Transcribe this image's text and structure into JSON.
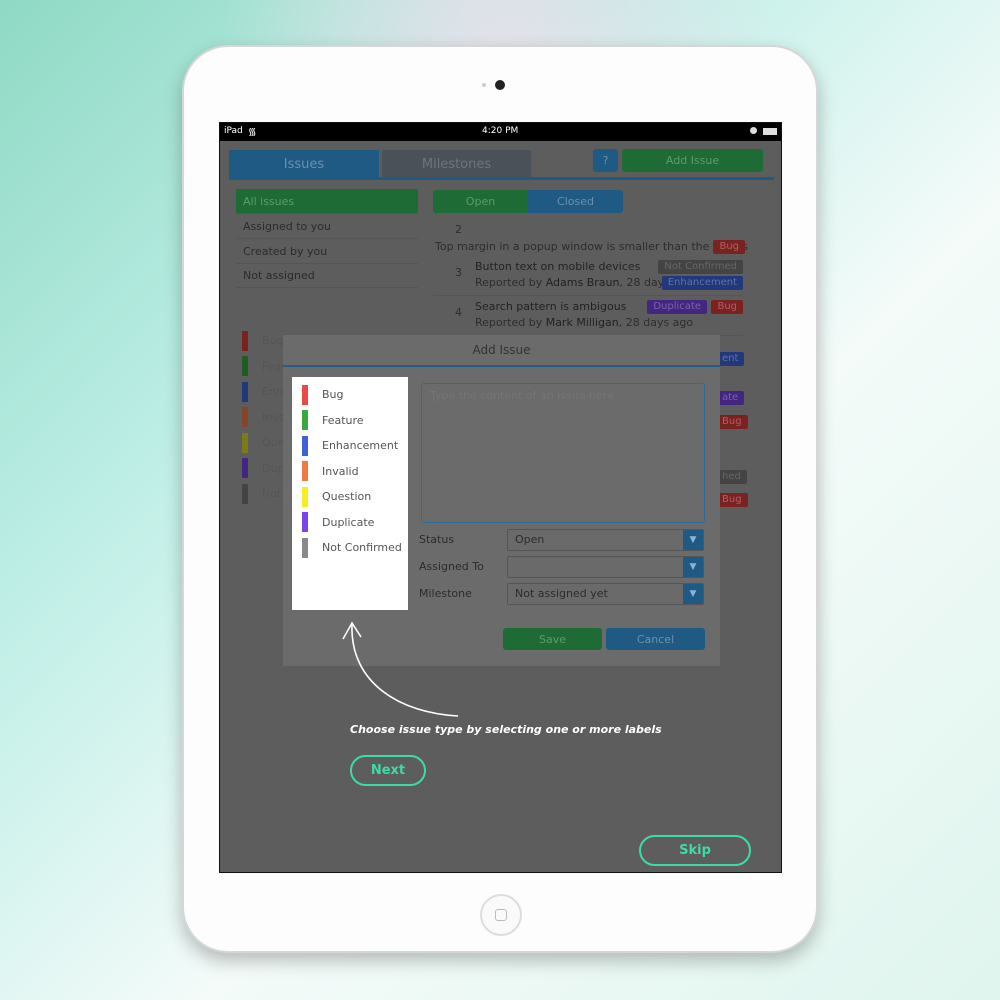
{
  "status_bar": {
    "carrier": "iPad",
    "time": "4:20 PM"
  },
  "tabs": [
    {
      "label": "Issues"
    },
    {
      "label": "Milestones"
    }
  ],
  "header": {
    "help_label": "?",
    "add_issue_label": "Add Issue"
  },
  "sidebar": {
    "items": [
      {
        "label": "All issues"
      },
      {
        "label": "Assigned to you"
      },
      {
        "label": "Created by you"
      },
      {
        "label": "Not assigned"
      }
    ],
    "labels": [
      {
        "label": "Bug"
      },
      {
        "label": "Feature"
      },
      {
        "label": "Enhancement"
      },
      {
        "label": "Invalid"
      },
      {
        "label": "Question"
      },
      {
        "label": "Duplicate"
      },
      {
        "label": "Not Confirmed"
      }
    ]
  },
  "filter": {
    "open_label": "Open",
    "closed_label": "Closed"
  },
  "issues": [
    {
      "number": "2",
      "title": "Top margin in a popup window is smaller than the others",
      "badges": [
        "Bug"
      ]
    },
    {
      "number": "3",
      "title": "Button text on mobile devices",
      "reported_prefix": "Reported by ",
      "author": "Adams Braun",
      "age": ", 28 days ago",
      "badges": [
        "Not Confirmed",
        "Enhancement"
      ]
    },
    {
      "number": "4",
      "title": "Search pattern is ambigous",
      "reported_prefix": "Reported by ",
      "author": "Mark Milligan",
      "age": ", 28 days ago",
      "badges": [
        "Duplicate",
        "Bug"
      ]
    }
  ],
  "partial_badges": [
    "ent",
    "ate",
    "Bug",
    "hed",
    "Bug"
  ],
  "modal": {
    "title": "Add Issue",
    "labels": [
      {
        "label": "Bug",
        "color": "#e84a4a"
      },
      {
        "label": "Feature",
        "color": "#3aa83e"
      },
      {
        "label": "Enhancement",
        "color": "#3b63d6"
      },
      {
        "label": "Invalid",
        "color": "#f07a45"
      },
      {
        "label": "Question",
        "color": "#f5ee22"
      },
      {
        "label": "Duplicate",
        "color": "#7a45e8"
      },
      {
        "label": "Not Confirmed",
        "color": "#8a8a8a"
      }
    ],
    "content_placeholder": "Type the content of an issue here",
    "status_label": "Status",
    "status_value": "Open",
    "assigned_label": "Assigned To",
    "assigned_value": "",
    "milestone_label": "Milestone",
    "milestone_value": "Not assigned yet",
    "save_label": "Save",
    "cancel_label": "Cancel"
  },
  "tour": {
    "hint": "Choose issue type by selecting one or more labels",
    "next_label": "Next",
    "skip_label": "Skip"
  },
  "colors": {
    "accent_teal": "#3ddba8",
    "green": "#1e6b36",
    "blue": "#1f5a85"
  }
}
